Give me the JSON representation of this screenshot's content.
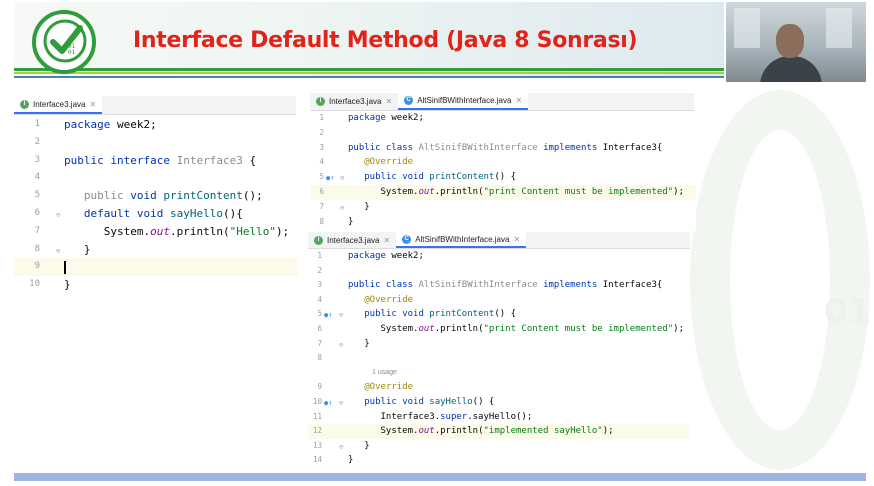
{
  "slide": {
    "title": "Interface Default Method (Java 8 Sonrası)",
    "logo_bits": [
      "01",
      "01"
    ],
    "watermark_text": "01"
  },
  "colors": {
    "title": "#e2231a",
    "brand_green": "#2f9d3b",
    "keyword": "#0033b3",
    "annotation": "#9e880d",
    "string": "#067d17",
    "method": "#00627a",
    "field": "#871094",
    "active_tab_underline": "#3574f0"
  },
  "editor_left": {
    "tab": {
      "label": "Interface3.java",
      "icon": "interface-file-icon"
    },
    "lines": [
      {
        "n": "1",
        "code": "package week2;"
      },
      {
        "n": "2",
        "code": ""
      },
      {
        "n": "3",
        "code": "public interface Interface3 {"
      },
      {
        "n": "4",
        "code": ""
      },
      {
        "n": "5",
        "code": "    public void printContent();"
      },
      {
        "n": "6",
        "code": "    default void sayHello(){"
      },
      {
        "n": "7",
        "code": "        System.out.println(\"Hello\");"
      },
      {
        "n": "8",
        "code": "    }"
      },
      {
        "n": "9",
        "code": ""
      },
      {
        "n": "10",
        "code": "}"
      }
    ]
  },
  "editor_top_right": {
    "tabs": [
      {
        "label": "Interface3.java",
        "icon": "interface-file-icon"
      },
      {
        "label": "AltSinifBWithInterface.java",
        "icon": "class-file-icon"
      }
    ],
    "lines": [
      {
        "n": "1",
        "code": "package week2;"
      },
      {
        "n": "2",
        "code": ""
      },
      {
        "n": "3",
        "code": "public class AltSinifBWithInterface implements Interface3{"
      },
      {
        "n": "4",
        "code": "    @Override"
      },
      {
        "n": "5",
        "code": "    public void printContent() {"
      },
      {
        "n": "6",
        "code": "        System.out.println(\"print Content must be implemented\");"
      },
      {
        "n": "7",
        "code": "    }"
      },
      {
        "n": "8",
        "code": "}"
      }
    ]
  },
  "editor_bottom_right": {
    "tabs": [
      {
        "label": "Interface3.java",
        "icon": "interface-file-icon"
      },
      {
        "label": "AltSinifBWithInterface.java",
        "icon": "class-file-icon"
      }
    ],
    "usage_hint": "1 usage",
    "lines": [
      {
        "n": "1",
        "code": "package week2;"
      },
      {
        "n": "2",
        "code": ""
      },
      {
        "n": "3",
        "code": "public class AltSinifBWithInterface implements Interface3{"
      },
      {
        "n": "4",
        "code": "    @Override"
      },
      {
        "n": "5",
        "code": "    public void printContent() {"
      },
      {
        "n": "6",
        "code": "        System.out.println(\"print Content must be implemented\");"
      },
      {
        "n": "7",
        "code": "    }"
      },
      {
        "n": "8",
        "code": ""
      },
      {
        "n": "9",
        "code": "    @Override"
      },
      {
        "n": "10",
        "code": "    public void sayHello() {"
      },
      {
        "n": "11",
        "code": "        Interface3.super.sayHello();"
      },
      {
        "n": "12",
        "code": "        System.out.println(\"implemented sayHello\");"
      },
      {
        "n": "13",
        "code": "    }"
      },
      {
        "n": "14",
        "code": "}"
      }
    ]
  }
}
